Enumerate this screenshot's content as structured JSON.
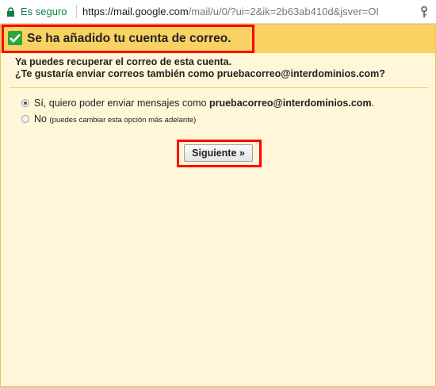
{
  "browser": {
    "secure_label": "Es seguro",
    "url_host": "https://mail.google.com",
    "url_rest": "/mail/u/0/?ui=2&ik=2b63ab410d&jsver=OI"
  },
  "popup": {
    "title": "Se ha añadido tu cuenta de correo.",
    "intro_line1": "Ya puedes recuperar el correo de esta cuenta.",
    "intro_line2": "¿Te gustaría enviar correos también como pruebacorreo@interdominios.com?",
    "option_yes_prefix": "Sí, quiero poder enviar mensajes como",
    "option_yes_email": "pruebacorreo@interdominios.com",
    "option_yes_suffix": ".",
    "option_no_label": "No",
    "option_no_note": "(puedes cambiar esta opción más adelante)",
    "next_button": "Siguiente »",
    "selected_option": "yes"
  },
  "colors": {
    "header_bg": "#fad163",
    "popup_bg": "#fff7d7",
    "highlight": "#ff0000",
    "secure_green": "#0b8043",
    "check_green": "#2fa53e"
  }
}
